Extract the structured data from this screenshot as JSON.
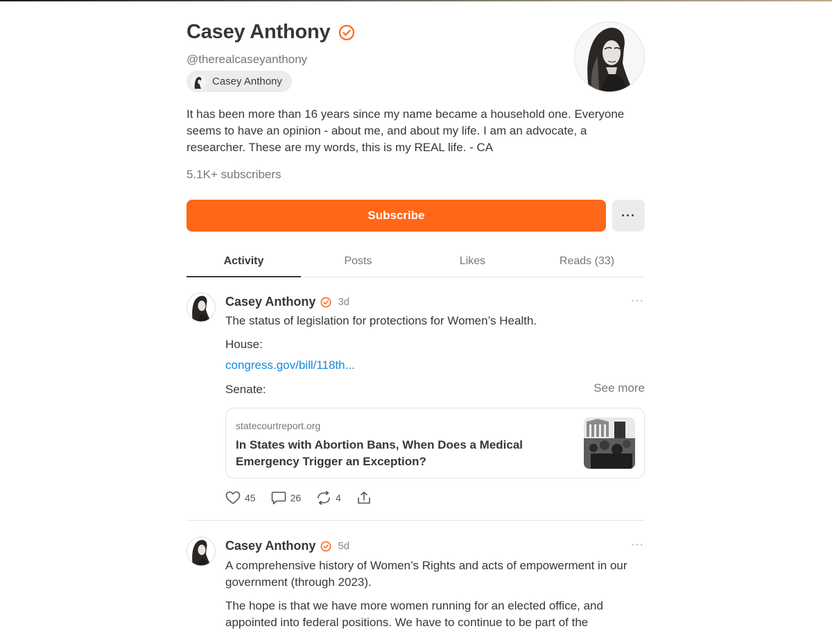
{
  "profile": {
    "name": "Casey Anthony",
    "handle": "@therealcaseyanthony",
    "publication": "Casey Anthony",
    "bio": "It has been more than 16 years since my name became a household one. Everyone seems to have an opinion - about me, and about my life. I am an advocate, a researcher. These are my words, this is my REAL life. - CA",
    "subscribers": "5.1K+ subscribers",
    "subscribe_label": "Subscribe",
    "more_label": "···"
  },
  "tabs": [
    "Activity",
    "Posts",
    "Likes",
    "Reads (33)"
  ],
  "posts": [
    {
      "author": "Casey Anthony",
      "time": "3d",
      "menu": "···",
      "line1": "The status of legislation for protections for Women’s Health.",
      "line2": "House:",
      "link": "congress.gov/bill/118th...",
      "line3": "Senate:",
      "see_more": "See more",
      "card": {
        "domain": "statecourtreport.org",
        "title": "In States with Abortion Bans, When Does a Medical Emergency Trigger an Exception?"
      },
      "likes": "45",
      "comments": "26",
      "restacks": "4"
    },
    {
      "author": "Casey Anthony",
      "time": "5d",
      "menu": "···",
      "line1": "A comprehensive history of Women’s Rights and acts of empowerment in our government (through 2023).",
      "line2": "The hope is that we have more women running for an elected office, and appointed into federal positions. We have to continue to be part of the"
    }
  ],
  "colors": {
    "accent": "#ff6719",
    "link": "#0f8ae0",
    "text": "#363737",
    "muted": "#777777"
  }
}
